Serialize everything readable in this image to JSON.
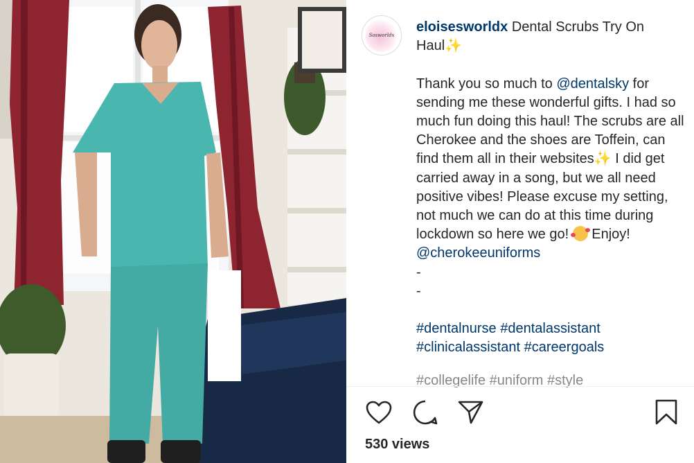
{
  "post": {
    "username": "eloisesworldx",
    "avatar_text": "Sosworldx",
    "title": "Dental Scrubs Try On Haul",
    "sparkle": "✨",
    "body_1a": "Thank you so much to ",
    "mention_1": "@dentalsky",
    "body_1b": " for sending me these wonderful gifts. I had so much fun doing this haul! The scrubs are all Cherokee and the shoes are Toffein, can find them all in their websites",
    "body_1c": " I did get carried away in a song, but we all need positive vibes! Please excuse my setting, not much we can do at this time during lockdown so here we go! ",
    "body_1d": " Enjoy!",
    "mention_2": "@cherokeeuniforms",
    "dash_1": "-",
    "dash_2": "-",
    "hashtags": [
      "#dentalnurse",
      "#dentalassistant",
      "#clinicalassistant",
      "#careergoals"
    ],
    "hashtag_overflow": "#collegelife #uniform #style"
  },
  "actions": {
    "like_icon": "heart-icon",
    "comment_icon": "comment-icon",
    "share_icon": "share-icon",
    "save_icon": "bookmark-icon"
  },
  "stats": {
    "views": "530 views"
  },
  "colors": {
    "link": "#00376b",
    "text": "#262626",
    "scrubs": "#49b6b0"
  }
}
